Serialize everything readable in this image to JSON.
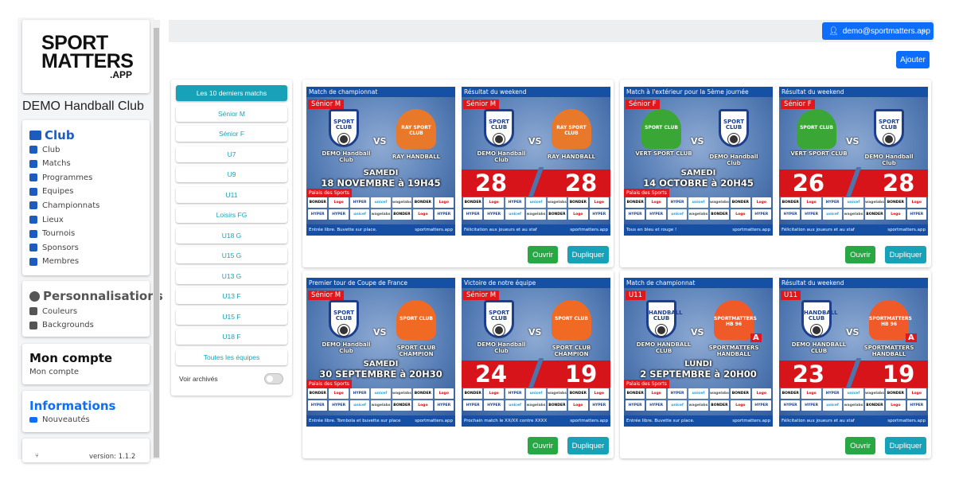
{
  "sidebar": {
    "logo": {
      "line1": "SPORT",
      "line2": "MATTERS",
      "line3": ".APP"
    },
    "club_name": "DEMO Handball Club",
    "club_section": {
      "title": "Club",
      "items": [
        {
          "label": "Club",
          "icon": "shirt-icon"
        },
        {
          "label": "Matchs",
          "icon": "trophy-icon"
        },
        {
          "label": "Programmes",
          "icon": "table-icon"
        },
        {
          "label": "Equipes",
          "icon": "users-icon"
        },
        {
          "label": "Championnats",
          "icon": "fire-icon"
        },
        {
          "label": "Lieux",
          "icon": "home-icon"
        },
        {
          "label": "Tournois",
          "icon": "calendar-check-icon"
        },
        {
          "label": "Sponsors",
          "icon": "google-icon"
        },
        {
          "label": "Membres",
          "icon": "users-icon"
        }
      ]
    },
    "custom_section": {
      "title": "Personnalisations",
      "items": [
        {
          "label": "Couleurs",
          "icon": "palette-icon"
        },
        {
          "label": "Backgrounds",
          "icon": "image-icon"
        }
      ]
    },
    "account_section": {
      "title": "Mon compte",
      "items": [
        {
          "label": "Mon compte"
        }
      ]
    },
    "info_section": {
      "title": "Informations",
      "items": [
        {
          "label": "Nouveautés",
          "icon": "newspaper-icon"
        }
      ]
    },
    "version": "version: 1.1.2"
  },
  "header": {
    "user_email": "demo@sportmatters.app",
    "add_label": "Ajouter"
  },
  "colors": {
    "primary": "#0d6efd",
    "info": "#17a2b8",
    "success": "#28a745",
    "poster_blue": "#1550a5",
    "poster_red": "#e3161b",
    "club_blue": "#1c5bbf"
  },
  "filters": {
    "items": [
      "Les 10 derniers matchs",
      "Sénior M",
      "Sénior F",
      "U7",
      "U9",
      "U11",
      "Loisirs FG",
      "U18 G",
      "U15 G",
      "U13 G",
      "U13 F",
      "U15 F",
      "U18 F",
      "Toutes les équipes"
    ],
    "active": 0,
    "archived_label": "Voir archivés",
    "archived_on": false
  },
  "card_actions": {
    "open": "Ouvrir",
    "duplicate": "Dupliquer"
  },
  "sponsors": [
    "BONDER",
    "Logo",
    "HYPER",
    "unicef",
    "wagelabs",
    "BONDER",
    "Logo",
    "HYPER",
    "HYPER",
    "unicef",
    "wagelabs",
    "BONDER",
    "Logo",
    "HYPER"
  ],
  "watermark": "sportmatters.app",
  "cards": [
    {
      "posters": [
        {
          "title": "Match de championnat",
          "category": "Sénior M",
          "home": "DEMO Handball Club",
          "home_logo": "SPORT CLUB",
          "away": "RAY HANDBALL",
          "away_logo": "RAY SPORT CLUB",
          "away_color": "#e8782a",
          "day": "SAMEDI",
          "date": "18 NOVEMBRE à 19H45",
          "venue": "Palais des Sports",
          "footer": "Entrée libre. Buvette sur place."
        },
        {
          "title": "Résultat du weekend",
          "category": "Sénior M",
          "home": "DEMO Handball Club",
          "home_logo": "SPORT CLUB",
          "away": "RAY HANDBALL",
          "away_logo": "RAY SPORT CLUB",
          "away_color": "#e8782a",
          "score_home": "28",
          "score_away": "28",
          "footer": "Félicitation aux joueurs et au staf"
        }
      ]
    },
    {
      "posters": [
        {
          "title": "Match à l'extérieur pour la 5ème journée",
          "category": "Sénior F",
          "home": "VERT SPORT CLUB",
          "home_logo": "SPORT CLUB",
          "home_color": "#3aa635",
          "away": "DEMO Handball Club",
          "away_logo": "SPORT CLUB",
          "away_shield": true,
          "day": "SAMEDI",
          "date": "14 OCTOBRE à 20H45",
          "venue": "Palais des Sports",
          "footer": "Tous en bleu et rouge !"
        },
        {
          "title": "Résultat du weekend",
          "category": "Sénior F",
          "home": "VERT SPORT CLUB",
          "home_logo": "SPORT CLUB",
          "home_color": "#3aa635",
          "away": "DEMO Handball Club",
          "away_logo": "SPORT CLUB",
          "away_shield": true,
          "score_home": "26",
          "score_away": "28",
          "footer": "Félicitation aux joueurs et au staf"
        }
      ]
    },
    {
      "posters": [
        {
          "title": "Premier tour de Coupe de France",
          "category": "Sénior M",
          "home": "DEMO Handball Club",
          "home_logo": "SPORT CLUB",
          "away": "SPORT CLUB CHAMPION",
          "away_logo": "SPORT CLUB",
          "away_color": "#f06a23",
          "day": "SAMEDI",
          "date": "30 SEPTEMBRE à 20H30",
          "venue": "Palais des Sports",
          "footer": "Entrée libre. Tombola et buvette sur place"
        },
        {
          "title": "Victoire de notre équipe",
          "category": "Sénior M",
          "home": "DEMO Handball Club",
          "home_logo": "SPORT CLUB",
          "away": "SPORT CLUB CHAMPION",
          "away_logo": "SPORT CLUB",
          "away_color": "#f06a23",
          "score_home": "24",
          "score_away": "19",
          "footer": "Prochain match le XX/XX contre XXXX"
        }
      ]
    },
    {
      "posters": [
        {
          "title": "Match de championnat",
          "category": "U11",
          "home": "DEMO HANDBALL CLUB",
          "home_logo": "HANDBALL CLUB",
          "away": "SPORTMATTERS HANDBALL",
          "away_logo": "SPORTMATTERS HB 96",
          "away_color": "#f05a28",
          "away_badge": "A",
          "day": "LUNDI",
          "date": "2 SEPTEMBRE à 20H00",
          "venue": "Palais des Sports",
          "footer": "Entrée libre. Buvette sur place."
        },
        {
          "title": "Résultat du weekend",
          "category": "U11",
          "home": "DEMO HANDBALL CLUB",
          "home_logo": "HANDBALL CLUB",
          "away": "SPORTMATTERS HANDBALL",
          "away_logo": "SPORTMATTERS HB 96",
          "away_color": "#f05a28",
          "away_badge": "A",
          "score_home": "23",
          "score_away": "19",
          "footer": "Félicitation aux joueurs et au staf"
        }
      ]
    }
  ]
}
